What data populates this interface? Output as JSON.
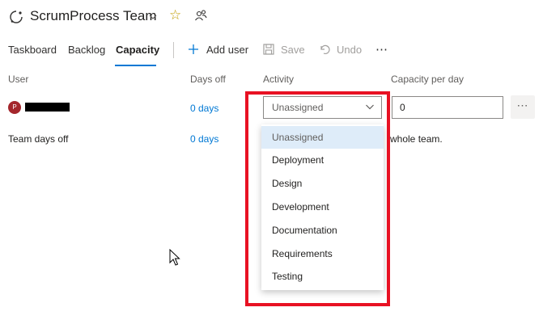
{
  "header": {
    "team_name": "ScrumProcess Team",
    "team_icon": "team-loop-icon",
    "favorite_icon": "star-icon",
    "members_icon": "people-icon",
    "accent_star": "#c19c00"
  },
  "tabs": [
    {
      "label": "Taskboard"
    },
    {
      "label": "Backlog"
    },
    {
      "label": "Capacity"
    }
  ],
  "commands": {
    "add_user": "Add user",
    "save": "Save",
    "undo": "Undo",
    "more": "⋯"
  },
  "columns": {
    "user": "User",
    "days_off": "Days off",
    "activity": "Activity",
    "capacity": "Capacity per day"
  },
  "rows": [
    {
      "avatar_initial": "P",
      "days_off": "0 days",
      "activity": "Unassigned",
      "capacity": "0",
      "more": "⋯"
    }
  ],
  "team_days_off": {
    "label": "Team days off",
    "days": "0 days",
    "note": "whole team."
  },
  "activity_options": [
    "Unassigned",
    "Deployment",
    "Design",
    "Development",
    "Documentation",
    "Requirements",
    "Testing"
  ],
  "colors": {
    "accent": "#0078d4",
    "highlight": "#e81123",
    "avatar": "#a4262c"
  }
}
